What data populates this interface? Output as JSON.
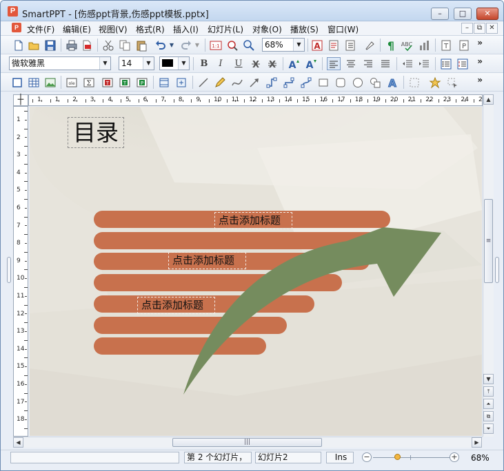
{
  "window": {
    "app_icon": "P",
    "title": "SmartPPT - [伤感ppt背景,伤感ppt模板.pptx]",
    "buttons": {
      "minimize": "–",
      "maximize": "□",
      "close": "✕"
    }
  },
  "menubar": {
    "items": [
      "文件(F)",
      "编辑(E)",
      "视图(V)",
      "格式(R)",
      "插入(I)",
      "幻灯片(L)",
      "对象(O)",
      "播放(S)",
      "窗口(W)"
    ],
    "mdi": {
      "minimize": "–",
      "restore": "⧉",
      "close": "✕"
    }
  },
  "toolbar1": {
    "zoom": "68%",
    "more": "»"
  },
  "toolbar2": {
    "font_name": "微软雅黑",
    "font_size": "14",
    "color": "#000000",
    "bold": "B",
    "italic": "I",
    "underline": "U",
    "more": "»"
  },
  "toolbar3": {
    "more": "»"
  },
  "rulers": {
    "horizontal": [
      "1",
      "1",
      "2",
      "3",
      "4",
      "5",
      "6",
      "7",
      "8",
      "9",
      "10",
      "11",
      "12",
      "13",
      "14",
      "15",
      "16",
      "17",
      "18",
      "19",
      "20",
      "21",
      "22",
      "23",
      "24",
      "25"
    ],
    "vertical": [
      "1",
      "2",
      "3",
      "4",
      "5",
      "6",
      "7",
      "8",
      "9",
      "10",
      "11",
      "12",
      "13",
      "14",
      "15",
      "16",
      "17",
      "18"
    ]
  },
  "slide": {
    "title": "目录",
    "placeholders": [
      "点击添加标题",
      "点击添加标题",
      "点击添加标题"
    ],
    "colors": {
      "bar": "#c8714d",
      "arrow": "#758c5e"
    }
  },
  "statusbar": {
    "info": "",
    "slide_count": "第 2 个幻灯片，",
    "slide_name": "幻灯片2",
    "mode": "Ins",
    "zoom": "68%"
  }
}
